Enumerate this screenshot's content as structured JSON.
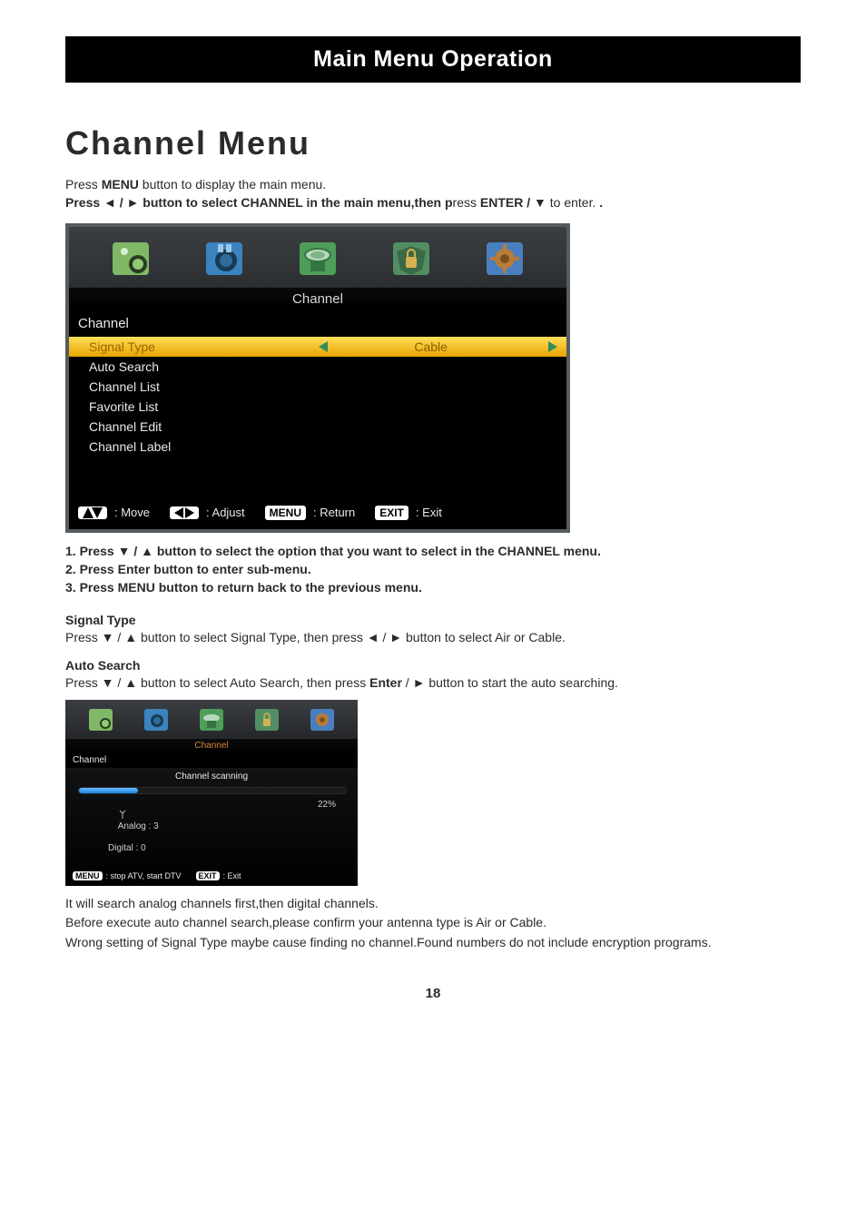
{
  "title_bar": "Main Menu Operation",
  "section_title": "Channel Menu",
  "intro": {
    "line1_pre": "Press ",
    "line1_menu": "MENU",
    "line1_post": " button  to display the main menu.",
    "line2_a": "Press ◄ / ► button to select ",
    "line2_channel": "CHANNEL",
    "line2_b": " in the main menu,then p",
    "line2_c": "ress ",
    "line2_enter": "ENTER / ▼",
    "line2_d": "  to  enter. ",
    "line2_dot": "."
  },
  "osd": {
    "icons": {
      "picture": "picture-mode-icon",
      "sound": "sound-mode-icon",
      "channel": "channel-icon",
      "lock": "lock-icon",
      "settings": "settings-gear-icon"
    },
    "tab_title": "Channel",
    "header": "Channel",
    "rows": [
      {
        "label": "Signal Type",
        "value": "Cable",
        "selected": true,
        "has_arrows": true
      },
      {
        "label": "Auto Search"
      },
      {
        "label": "Channel List"
      },
      {
        "label": "Favorite List"
      },
      {
        "label": "Channel Edit"
      },
      {
        "label": "Channel Label"
      }
    ],
    "hints": {
      "move": ": Move",
      "adjust": ": Adjust",
      "menu_box": "MENU",
      "return": ": Return",
      "exit_box": "EXIT",
      "exit": ": Exit"
    }
  },
  "bullets": {
    "b1": "1. Press ▼ / ▲ button  to select the option that you want to select in the CHANNEL menu.",
    "b2": "2. Press Enter button  to enter sub-menu.",
    "b3": "3. Press  MENU button to return back to the previous menu."
  },
  "signal_type": {
    "head": "Signal Type",
    "text": "Press ▼ / ▲ button to select Signal Type, then press ◄ / ► button to select Air or Cable."
  },
  "auto_search": {
    "head": "Auto Search",
    "text_a": "Press ▼ / ▲ button to select Auto Search,  then press ",
    "text_enter": "Enter",
    "text_b": " / ► button to start the auto searching."
  },
  "osd_sm": {
    "tab_title": "Channel",
    "header": "Channel",
    "scan_title": "Channel scanning",
    "analog_label": "Analog :",
    "analog_count": "3",
    "digital_label": "Digital :",
    "digital_count": "0",
    "percent": "22%",
    "menu_box": "MENU",
    "menu_hint": ": stop ATV, start DTV",
    "exit_box": "EXIT",
    "exit_hint": ": Exit"
  },
  "closing": {
    "p1": "It will search analog channels first,then digital channels.",
    "p2": "Before execute auto channel search,please confirm your antenna type is Air or Cable.",
    "p3": "Wrong setting of Signal Type maybe cause finding no channel.Found numbers do not include encryption programs."
  },
  "page_number": "18"
}
